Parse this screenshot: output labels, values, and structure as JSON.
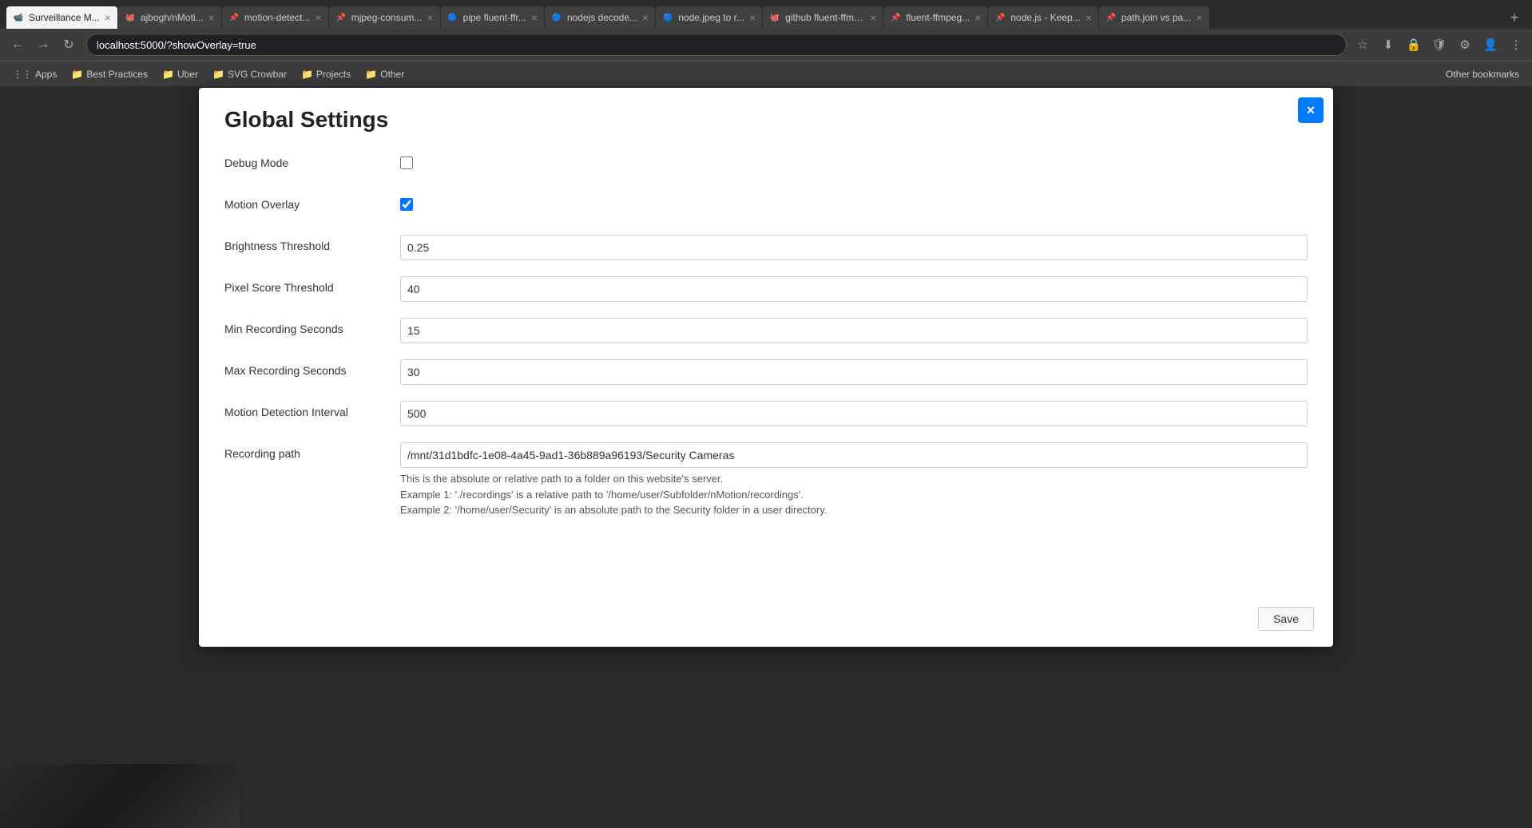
{
  "browser": {
    "tabs": [
      {
        "id": "t1",
        "label": "Surveillance M...",
        "favicon": "📹",
        "active": true
      },
      {
        "id": "t2",
        "label": "ajbogh/nMoti...",
        "favicon": "🐙",
        "active": false
      },
      {
        "id": "t3",
        "label": "motion-detect...",
        "favicon": "📌",
        "active": false
      },
      {
        "id": "t4",
        "label": "mjpeg-consum...",
        "favicon": "📌",
        "active": false
      },
      {
        "id": "t5",
        "label": "pipe fluent-ffr...",
        "favicon": "🔵",
        "active": false
      },
      {
        "id": "t6",
        "label": "nodejs decode...",
        "favicon": "🔵",
        "active": false
      },
      {
        "id": "t7",
        "label": "node.jpeg to r...",
        "favicon": "🔵",
        "active": false
      },
      {
        "id": "t8",
        "label": "github fluent-ffmpeg",
        "favicon": "🐙",
        "active": false
      },
      {
        "id": "t9",
        "label": "fluent-ffmpeg...",
        "favicon": "📌",
        "active": false
      },
      {
        "id": "t10",
        "label": "node.js - Keep...",
        "favicon": "📌",
        "active": false
      },
      {
        "id": "t11",
        "label": "path.join vs pa...",
        "favicon": "📌",
        "active": false
      }
    ],
    "new_tab_label": "+",
    "address": "localhost:5000/?showOverlay=true"
  },
  "bookmarks": [
    {
      "id": "b1",
      "label": "Apps",
      "icon": "⋮"
    },
    {
      "id": "b2",
      "label": "Best Practices",
      "icon": "📁"
    },
    {
      "id": "b3",
      "label": "Uber",
      "icon": "📁"
    },
    {
      "id": "b4",
      "label": "SVG Crowbar",
      "icon": "📁"
    },
    {
      "id": "b5",
      "label": "Projects",
      "icon": "📁"
    },
    {
      "id": "b6",
      "label": "Other",
      "icon": "📁"
    }
  ],
  "bookmarks_right": "Other bookmarks",
  "modal": {
    "title": "Global Settings",
    "close_label": "×",
    "fields": [
      {
        "id": "debug_mode",
        "label": "Debug Mode",
        "type": "checkbox",
        "checked": false
      },
      {
        "id": "motion_overlay",
        "label": "Motion Overlay",
        "type": "checkbox",
        "checked": true
      },
      {
        "id": "brightness_threshold",
        "label": "Brightness Threshold",
        "type": "text",
        "value": "0.25"
      },
      {
        "id": "pixel_score_threshold",
        "label": "Pixel Score Threshold",
        "type": "text",
        "value": "40"
      },
      {
        "id": "min_recording_seconds",
        "label": "Min Recording Seconds",
        "type": "text",
        "value": "15"
      },
      {
        "id": "max_recording_seconds",
        "label": "Max Recording Seconds",
        "type": "text",
        "value": "30"
      },
      {
        "id": "motion_detection_interval",
        "label": "Motion Detection Interval",
        "type": "text",
        "value": "500"
      },
      {
        "id": "recording_path",
        "label": "Recording path",
        "type": "text",
        "value": "/mnt/31d1bdfc-1e08-4a45-9ad1-36b889a96193/Security Cameras",
        "help": [
          "This is the absolute or relative path to a folder on this website's server.",
          "Example 1: './recordings' is a relative path to '/home/user/Subfolder/nMotion/recordings'.",
          "Example 2: '/home/user/Security' is an absolute path to the Security folder in a user directory."
        ]
      }
    ],
    "save_label": "Save"
  }
}
